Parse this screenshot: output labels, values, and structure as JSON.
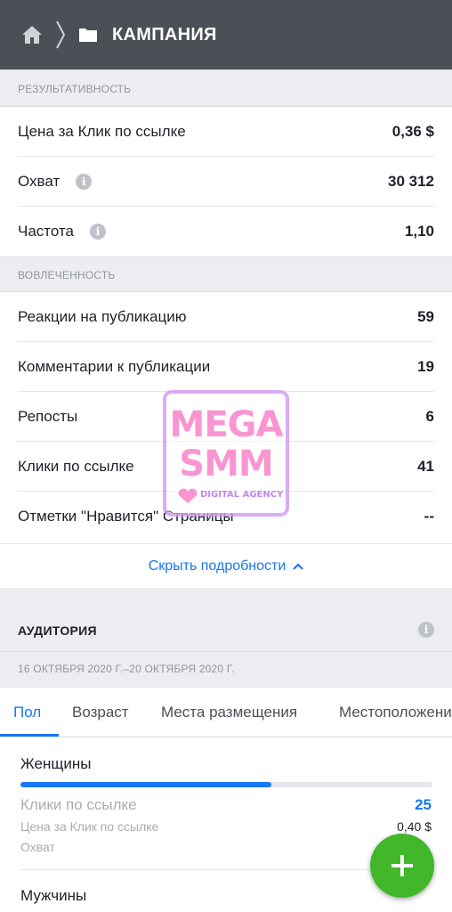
{
  "header": {
    "title": "КАМПАНИЯ"
  },
  "performance": {
    "section_label": "РЕЗУЛЬТАТИВНОСТЬ",
    "rows": [
      {
        "label": "Цена за Клик по ссылке",
        "value": "0,36 $"
      },
      {
        "label": "Охват",
        "value": "30 312"
      },
      {
        "label": "Частота",
        "value": "1,10"
      }
    ]
  },
  "engagement": {
    "section_label": "ВОВЛЕЧЕННОСТЬ",
    "rows": [
      {
        "label": "Реакции на публикацию",
        "value": "59"
      },
      {
        "label": "Комментарии к публикации",
        "value": "19"
      },
      {
        "label": "Репосты",
        "value": "6"
      },
      {
        "label": "Клики по ссылке",
        "value": "41"
      },
      {
        "label": "Отметки \"Нравится\" Страницы",
        "value": "--"
      }
    ]
  },
  "toggle": {
    "label": "Скрыть подробности"
  },
  "audience": {
    "title": "АУДИТОРИЯ",
    "date_range": "16 ОКТЯБРЯ 2020 Г.–20 ОКТЯБРЯ 2020 Г.",
    "tabs": [
      "Пол",
      "Возраст",
      "Места размещения",
      "Местоположение"
    ],
    "active_tab": 0,
    "groups": [
      {
        "label": "Женщины",
        "bar_fraction": 0.61,
        "metrics": [
          {
            "label": "Клики по ссылке",
            "value": "25"
          },
          {
            "label": "Цена за Клик по ссылке",
            "value": "0,40 $"
          },
          {
            "label": "Охват",
            "value": ""
          }
        ]
      },
      {
        "label": "Мужчины"
      }
    ]
  },
  "watermark": {
    "line1": "MEGA",
    "line2": "SMM",
    "line3": "DIGITAL AGENCY"
  },
  "colors": {
    "topbar": "#4b4f56",
    "accent": "#1877f2",
    "fab": "#42b72a",
    "section_bg": "#ebedf0"
  }
}
